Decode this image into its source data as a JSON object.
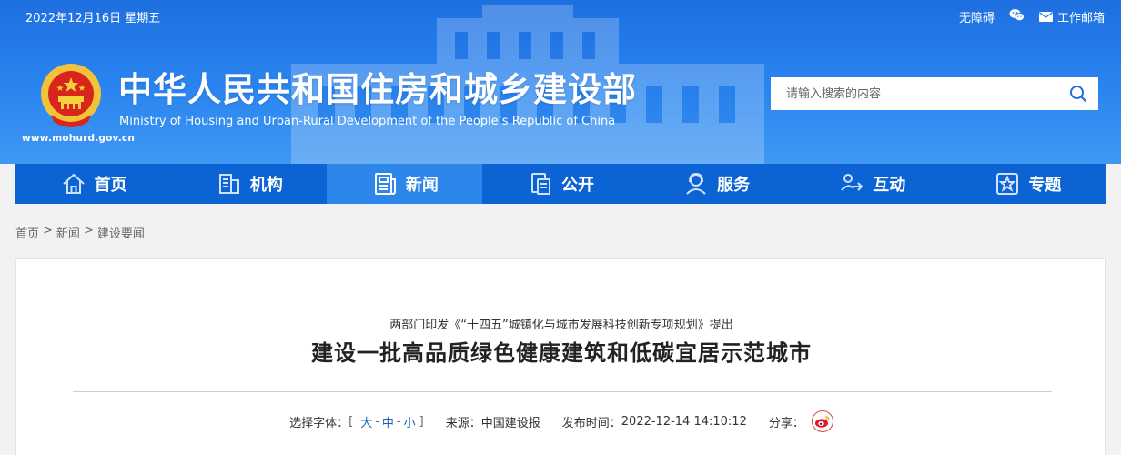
{
  "topbar": {
    "date": "2022年12月16日 星期五",
    "links": {
      "accessibility": "无障碍",
      "wechat_icon": "wechat-icon",
      "mail_icon": "mail-icon",
      "mail": "工作邮箱"
    }
  },
  "header": {
    "url": "www.mohurd.gov.cn",
    "title": "中华人民共和国住房和城乡建设部",
    "subtitle": "Ministry of Housing and Urban-Rural Development of the People’s Republic of China",
    "emblem_icon": "national-emblem-icon"
  },
  "search": {
    "placeholder": "请输入搜索的内容",
    "icon": "search-icon"
  },
  "nav": {
    "active_index": 2,
    "items": [
      {
        "label": "首页",
        "icon": "home-icon"
      },
      {
        "label": "机构",
        "icon": "building-icon"
      },
      {
        "label": "新闻",
        "icon": "newspaper-icon"
      },
      {
        "label": "公开",
        "icon": "document-icon"
      },
      {
        "label": "服务",
        "icon": "service-icon"
      },
      {
        "label": "互动",
        "icon": "interact-icon"
      },
      {
        "label": "专题",
        "icon": "star-icon"
      }
    ]
  },
  "breadcrumb": {
    "items": [
      "首页",
      "新闻",
      "建设要闻"
    ],
    "separator": ">"
  },
  "article": {
    "pre_title": "两部门印发《“十四五”城镇化与城市发展科技创新专项规划》提出",
    "title": "建设一批高品质绿色健康建筑和低碳宜居示范城市",
    "font_size_label": "选择字体：",
    "font_sizes": {
      "open": "[",
      "large": "大",
      "dash": "-",
      "medium": "中",
      "small": "小",
      "close": "]"
    },
    "source_label": "来源：",
    "source": "中国建设报",
    "time_label": "发布时间：",
    "time": "2022-12-14 14:10:12",
    "share_label": "分享：",
    "share_icon": "weibo-icon"
  },
  "colors": {
    "header_blue": "#1e6fe0",
    "nav_blue": "#0c64d4",
    "nav_active": "#2d86ea",
    "link_blue": "#1a5fb4",
    "weibo_red": "#d9493b"
  }
}
